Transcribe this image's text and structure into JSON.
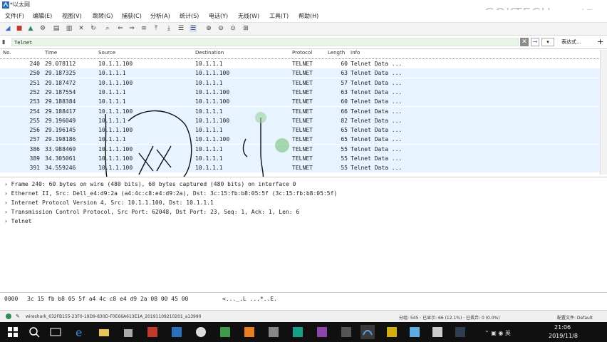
{
  "window": {
    "title": "*以太网"
  },
  "watermark": {
    "text": "GOKTECH",
    "char": "郭"
  },
  "menu": [
    "文件(F)",
    "编辑(E)",
    "视图(V)",
    "跳转(G)",
    "捕获(C)",
    "分析(A)",
    "统计(S)",
    "电话(Y)",
    "无线(W)",
    "工具(T)",
    "帮助(H)"
  ],
  "filter": {
    "value": "Telnet",
    "expression_label": "表达式…",
    "plus": "+"
  },
  "columns": [
    "No.",
    "Time",
    "Source",
    "Destination",
    "Protocol",
    "Length",
    "Info"
  ],
  "packets": [
    [
      "240",
      "29.078112",
      "10.1.1.100",
      "10.1.1.1",
      "TELNET",
      "60",
      "Telnet Data ..."
    ],
    [
      "250",
      "29.187325",
      "10.1.1.1",
      "10.1.1.100",
      "TELNET",
      "63",
      "Telnet Data ..."
    ],
    [
      "251",
      "29.187472",
      "10.1.1.100",
      "10.1.1.1",
      "TELNET",
      "57",
      "Telnet Data ..."
    ],
    [
      "252",
      "29.187554",
      "10.1.1.1",
      "10.1.1.100",
      "TELNET",
      "63",
      "Telnet Data ..."
    ],
    [
      "253",
      "29.188384",
      "10.1.1.1",
      "10.1.1.100",
      "TELNET",
      "60",
      "Telnet Data ..."
    ],
    [
      "254",
      "29.188417",
      "10.1.1.100",
      "10.1.1.1",
      "TELNET",
      "66",
      "Telnet Data ..."
    ],
    [
      "255",
      "29.196049",
      "10.1.1.1",
      "10.1.1.100",
      "TELNET",
      "82",
      "Telnet Data ..."
    ],
    [
      "256",
      "29.196145",
      "10.1.1.100",
      "10.1.1.1",
      "TELNET",
      "65",
      "Telnet Data ..."
    ],
    [
      "257",
      "29.198186",
      "10.1.1.1",
      "10.1.1.100",
      "TELNET",
      "65",
      "Telnet Data ..."
    ],
    [
      "386",
      "33.988469",
      "10.1.1.100",
      "10.1.1.1",
      "TELNET",
      "55",
      "Telnet Data ..."
    ],
    [
      "389",
      "34.305061",
      "10.1.1.100",
      "10.1.1.1",
      "TELNET",
      "55",
      "Telnet Data ..."
    ],
    [
      "391",
      "34.559246",
      "10.1.1.100",
      "10.1.1.1",
      "TELNET",
      "55",
      "Telnet Data ..."
    ]
  ],
  "details": [
    "Frame 240: 60 bytes on wire (480 bits), 60 bytes captured (480 bits) on interface 0",
    "Ethernet II, Src: Dell_e4:d9:2a (a4:4c:c8:e4:d9:2a), Dst: 3c:15:fb:b8:05:5f (3c:15:fb:b8:05:5f)",
    "Internet Protocol Version 4, Src: 10.1.1.100, Dst: 10.1.1.1",
    "Transmission Control Protocol, Src Port: 62048, Dst Port: 23, Seq: 1, Ack: 1, Len: 6",
    "Telnet"
  ],
  "bytes": {
    "offset": "0000",
    "hex": "3c 15 fb b8 05 5f a4 4c  c8 e4 d9 2a 08 00 45 00",
    "ascii": "<..._.L ...*..E."
  },
  "status": {
    "file": "wireshark_632FB155-23F0-19D9-830D-F0E66A613E1A_20191109210201_a13990",
    "packets": "分组: 545 · 已显示: 66 (12.1%) · 已丢弃: 0 (0.0%)",
    "profile_label": "配置文件: Default"
  },
  "taskbar": {
    "time": "21:06",
    "date": "2019/11/8"
  },
  "colors": {
    "selected_row": "#ffffff",
    "alt_row": "#e7f3ff",
    "filter_bg": "#e8f6e8",
    "taskbar": "#101010"
  }
}
